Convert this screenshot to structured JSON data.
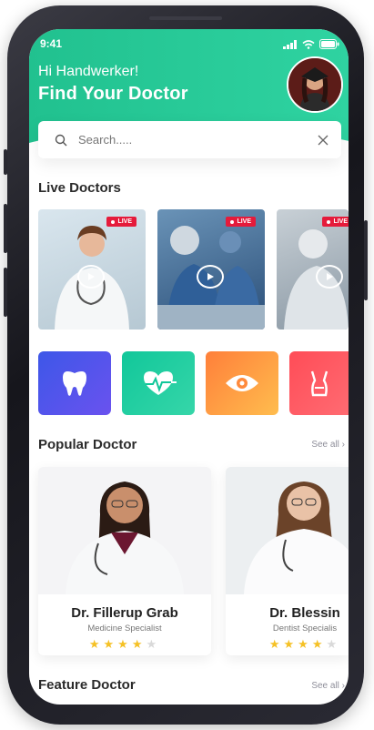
{
  "status": {
    "time": "9:41"
  },
  "header": {
    "greeting": "Hi Handwerker!",
    "title": "Find Your Doctor"
  },
  "search": {
    "placeholder": "Search....."
  },
  "live": {
    "title": "Live Doctors",
    "badge": "LIVE",
    "cards": [
      {
        "badge": "LIVE"
      },
      {
        "badge": "LIVE"
      },
      {
        "badge": "LIVE"
      }
    ]
  },
  "categories": [
    {
      "icon": "tooth-icon",
      "color_from": "#3d57e8",
      "color_to": "#6a52ef"
    },
    {
      "icon": "heart-icon",
      "color_from": "#11c79a",
      "color_to": "#36d6a9"
    },
    {
      "icon": "eye-icon",
      "color_from": "#ff7f3a",
      "color_to": "#ffbd4e"
    },
    {
      "icon": "body-icon",
      "color_from": "#ff4c57",
      "color_to": "#ff6b72"
    }
  ],
  "popular": {
    "title": "Popular Doctor",
    "see_all": "See all ›",
    "doctors": [
      {
        "name": "Dr. Fillerup Grab",
        "specialty": "Medicine Specialist",
        "rating": 4
      },
      {
        "name": "Dr. Blessin",
        "specialty": "Dentist Specialis",
        "rating": 4
      }
    ]
  },
  "feature": {
    "title": "Feature Doctor",
    "see_all": "See all ›"
  },
  "colors": {
    "accent": "#21c18f",
    "live": "#e51b3b",
    "star": "#f5c125"
  }
}
